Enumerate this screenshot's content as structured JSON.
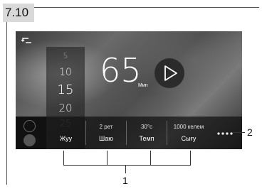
{
  "section": "7.10",
  "screen": {
    "back_icon": "back-arrow-icon",
    "time_picker": [
      "5",
      "10",
      "15",
      "20",
      "25"
    ],
    "time_value": "65",
    "time_unit": "Мин",
    "play_icon": "play-icon",
    "more_icon": "more-dots-icon",
    "tiles": [
      {
        "top": "",
        "label": "Жуу"
      },
      {
        "top": "2 рет",
        "label": "Шаю"
      },
      {
        "top": "30°c",
        "label": "Темп"
      },
      {
        "top": "1000 келем",
        "label": "Сығу"
      }
    ]
  },
  "callouts": {
    "one": "1",
    "two": "2"
  }
}
